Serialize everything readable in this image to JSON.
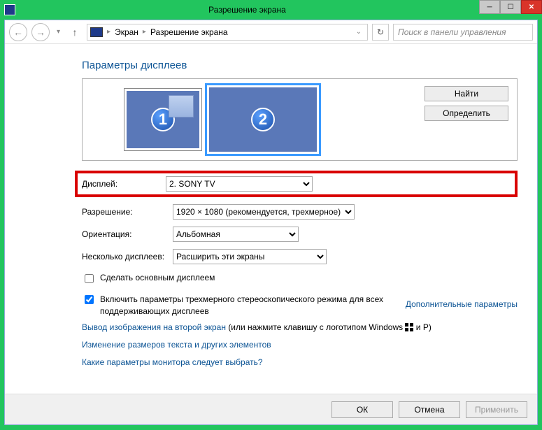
{
  "window": {
    "title": "Разрешение экрана"
  },
  "breadcrumb": {
    "root": "Экран",
    "current": "Разрешение экрана"
  },
  "search": {
    "placeholder": "Поиск в панели управления"
  },
  "page_title": "Параметры дисплеев",
  "monitors": {
    "one": "1",
    "two": "2"
  },
  "panel": {
    "detect": "Найти",
    "identify": "Определить"
  },
  "form": {
    "display_label": "Дисплей:",
    "display_value": "2. SONY TV",
    "resolution_label": "Разрешение:",
    "resolution_value": "1920 × 1080 (рекомендуется, трехмерное)",
    "orientation_label": "Ориентация:",
    "orientation_value": "Альбомная",
    "multi_label": "Несколько дисплеев:",
    "multi_value": "Расширить эти экраны"
  },
  "checkboxes": {
    "make_main": "Сделать основным дисплеем",
    "stereo3d": "Включить параметры трехмерного стереоскопического режима для всех поддерживающих дисплеев"
  },
  "links": {
    "advanced": "Дополнительные параметры",
    "project_prefix": "Вывод изображения на второй экран",
    "project_suffix": " (или нажмите клавишу с логотипом Windows ",
    "project_tail": " и P)",
    "text_size": "Изменение размеров текста и других элементов",
    "which_monitor": "Какие параметры монитора следует выбрать?"
  },
  "footer": {
    "ok": "ОК",
    "cancel": "Отмена",
    "apply": "Применить"
  }
}
